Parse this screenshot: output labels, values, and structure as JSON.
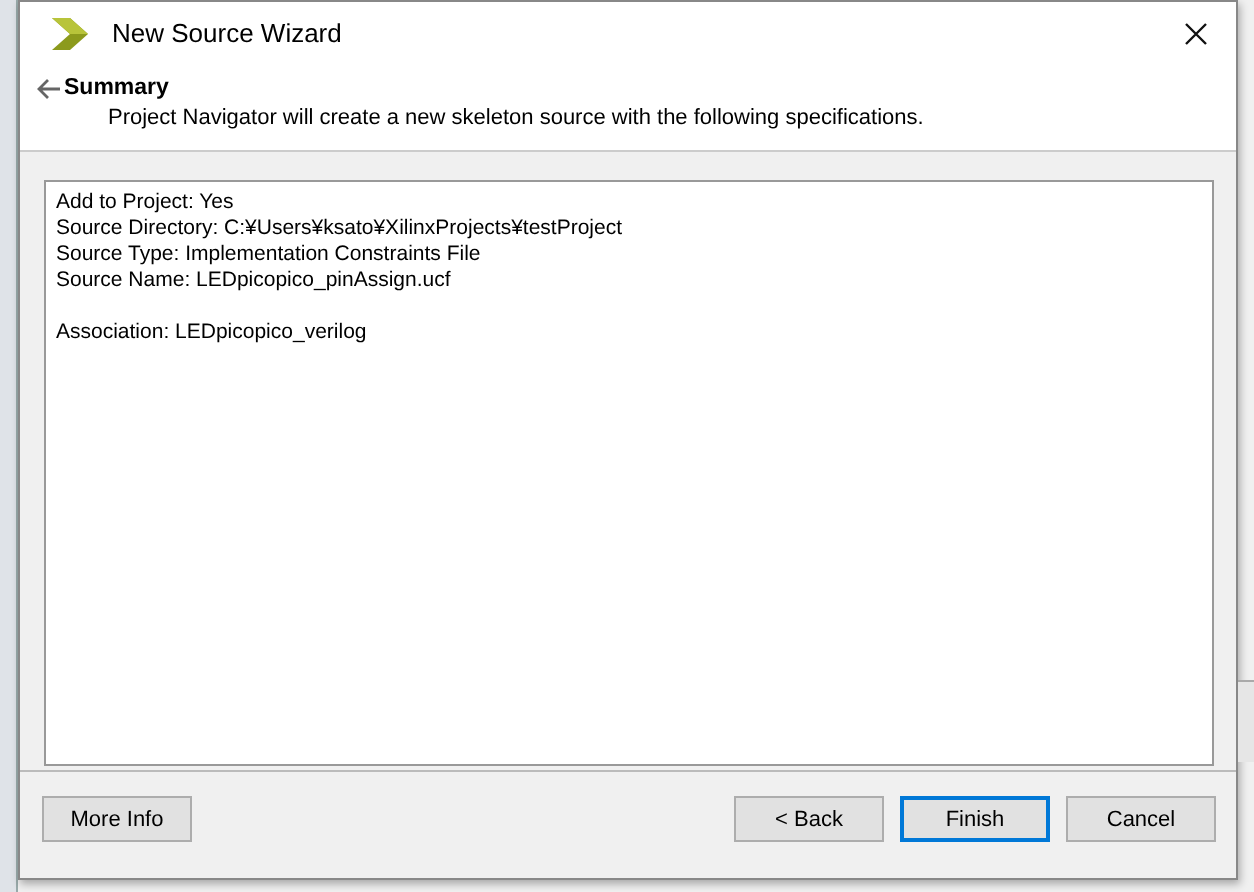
{
  "window": {
    "title": "New Source Wizard"
  },
  "header": {
    "title": "Summary",
    "subtitle": "Project Navigator will create a new skeleton source with the following specifications."
  },
  "summary": {
    "groups": [
      [
        "Add to Project: Yes",
        "Source Directory: C:¥Users¥ksato¥XilinxProjects¥testProject",
        "Source Type: Implementation Constraints File",
        "Source Name: LEDpicopico_pinAssign.ucf"
      ],
      [
        "Association: LEDpicopico_verilog"
      ]
    ]
  },
  "buttons": [
    {
      "label": "More Info",
      "kind": "help",
      "default": false
    },
    {
      "label": "< Back",
      "kind": "nav",
      "default": false
    },
    {
      "label": "Finish",
      "kind": "nav",
      "default": true
    },
    {
      "label": "Cancel",
      "kind": "nav",
      "default": false
    }
  ]
}
